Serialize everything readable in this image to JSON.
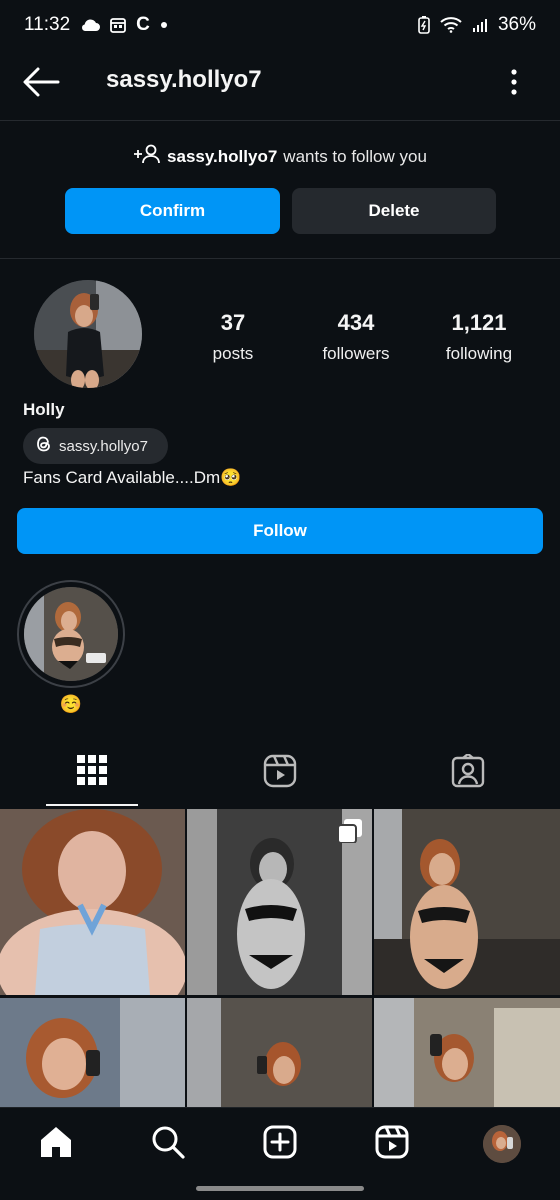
{
  "status": {
    "time": "11:32",
    "battery": "36%",
    "left_icons": [
      "cloud-icon",
      "calendar-icon",
      "c-app-icon",
      "dot-icon"
    ],
    "right_icons": [
      "battery-saver-icon",
      "wifi-icon",
      "signal-icon"
    ]
  },
  "header": {
    "username": "sassy.hollyo7"
  },
  "follow_request": {
    "username": "sassy.hollyo7",
    "text": "wants to follow you",
    "confirm_label": "Confirm",
    "delete_label": "Delete"
  },
  "profile": {
    "stats": [
      {
        "value": "37",
        "label": "posts"
      },
      {
        "value": "434",
        "label": "followers"
      },
      {
        "value": "1,121",
        "label": "following"
      }
    ],
    "display_name": "Holly",
    "threads_handle": "sassy.hollyo7",
    "bio": "Fans Card Available....Dm🥺",
    "follow_label": "Follow"
  },
  "highlights": [
    {
      "caption": "☺️"
    }
  ],
  "tabs": [
    "grid-icon",
    "reels-icon",
    "tagged-icon"
  ],
  "bottom_nav": [
    "home-icon",
    "search-icon",
    "create-icon",
    "reels-icon",
    "profile-avatar"
  ],
  "colors": {
    "background": "#0c1014",
    "primary_button": "#0095f6",
    "secondary_button": "#25292e"
  }
}
